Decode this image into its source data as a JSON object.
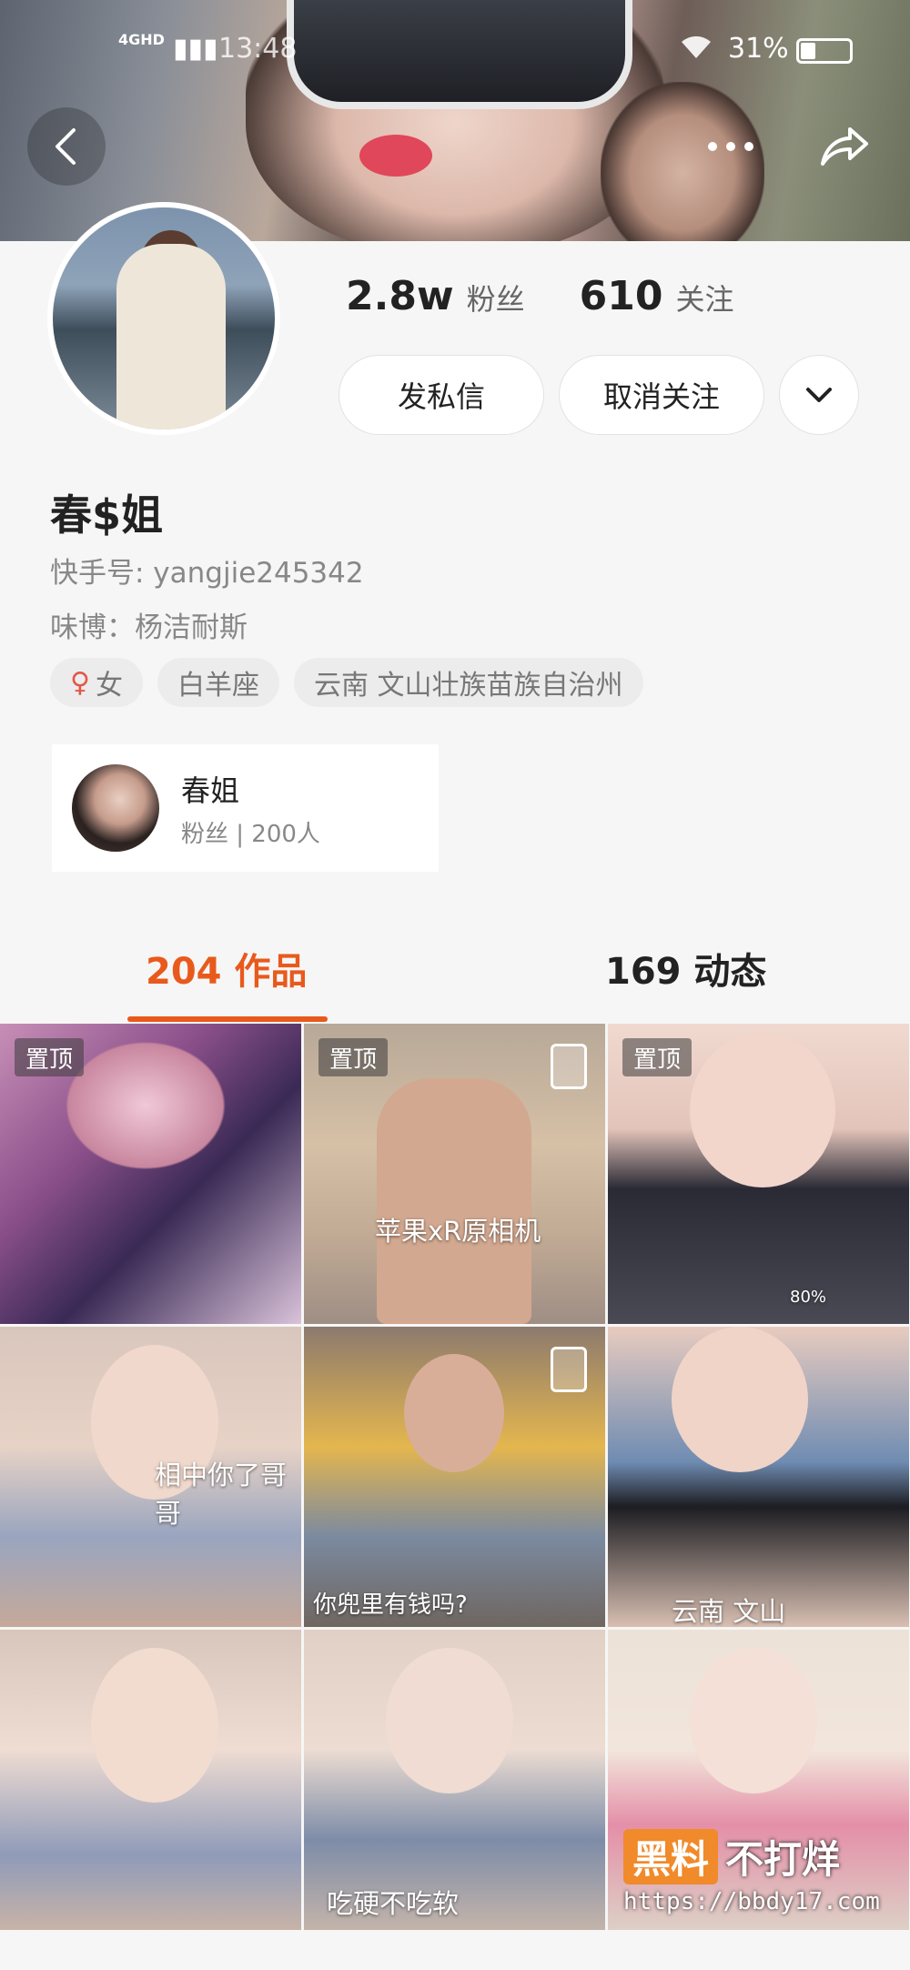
{
  "status_bar": {
    "network": "4GHD",
    "time": "13:48",
    "battery_text": "31%",
    "battery_level": 0.31
  },
  "profile": {
    "stats": [
      {
        "value": "2.8w",
        "label": "粉丝"
      },
      {
        "value": "610",
        "label": "关注"
      }
    ],
    "buttons": {
      "message": "发私信",
      "unfollow": "取消关注"
    },
    "name": "春$姐",
    "kuaishou_id": "快手号: yangjie245342",
    "weibo": "味博：杨洁耐斯",
    "tags": [
      {
        "symbol": "♀",
        "label": "女"
      },
      {
        "symbol": "",
        "label": "白羊座"
      },
      {
        "symbol": "",
        "label": "云南 文山壮族苗族自治州"
      }
    ],
    "fan_group": {
      "name": "春姐",
      "sub": "粉丝 | 200人"
    }
  },
  "tabs": {
    "works": "204 作品",
    "moments": "169 动态"
  },
  "grid": {
    "pinned_label": "置顶",
    "items": [
      {
        "pinned": true,
        "caption": ""
      },
      {
        "pinned": true,
        "caption": "苹果xR原相机",
        "video": true
      },
      {
        "pinned": true,
        "caption": "",
        "badge": "80%"
      },
      {
        "pinned": false,
        "caption": "相中你了哥哥"
      },
      {
        "pinned": false,
        "caption": "你兜里有钱吗?",
        "video": true
      },
      {
        "pinned": false,
        "caption": "云南 文山"
      },
      {
        "pinned": false,
        "caption": ""
      },
      {
        "pinned": false,
        "caption": "吃硬不吃软"
      },
      {
        "pinned": false,
        "caption": ""
      }
    ]
  },
  "watermark": {
    "badge": "黑料",
    "text": "不打烊",
    "url": "https://bbdy17.com"
  },
  "colors": {
    "accent": "#e85a1c",
    "background": "#f6f6f6"
  }
}
